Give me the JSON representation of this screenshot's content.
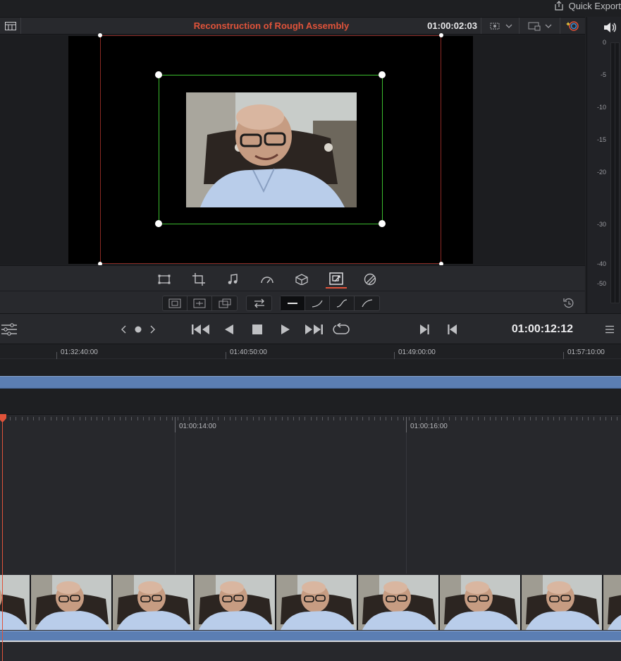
{
  "top_bar": {
    "quick_export_label": "Quick Export"
  },
  "viewer_header": {
    "title": "Reconstruction of Rough Assembly",
    "timecode": "01:00:02:03"
  },
  "audio_meter": {
    "ticks": [
      "0",
      "-5",
      "-10",
      "-15",
      "-20",
      "-30",
      "-40",
      "-50"
    ]
  },
  "viewer_tools": [
    "transform-icon",
    "crop-icon",
    "audio-icon",
    "speed-icon",
    "stabilize-icon",
    "dynamic-zoom-icon",
    "composite-icon"
  ],
  "active_tool": "dynamic-zoom-icon",
  "zoom_options": [
    "swap-icon"
  ],
  "ease_options": [
    "linear",
    "ease-in",
    "ease-in-out",
    "ease-out"
  ],
  "selected_ease": "linear",
  "transport": {
    "timecode": "01:00:12:12"
  },
  "upper_ruler": {
    "labels": [
      "01:32:40:00",
      "01:40:50:00",
      "01:49:00:00",
      "01:57:10:00"
    ]
  },
  "lower_ruler": {
    "labels": [
      "01:00:14:00",
      "01:00:16:00"
    ]
  },
  "colors": {
    "accent": "#e0533a",
    "clip": "#5b7eb3",
    "guide": "#3bbd2e"
  }
}
